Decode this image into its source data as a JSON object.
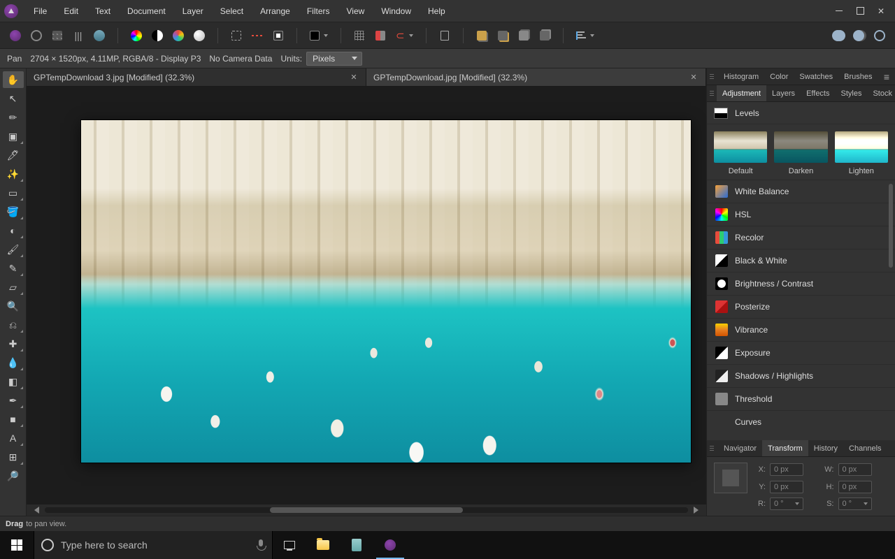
{
  "menubar": {
    "items": [
      "File",
      "Edit",
      "Text",
      "Document",
      "Layer",
      "Select",
      "Arrange",
      "Filters",
      "View",
      "Window",
      "Help"
    ]
  },
  "context": {
    "tool_mode": "Pan",
    "doc_info": "2704 × 1520px, 4.11MP, RGBA/8 - Display P3",
    "camera": "No Camera Data",
    "units_label": "Units:",
    "units_value": "Pixels"
  },
  "tabs": [
    {
      "title": "GPTempDownload 3.jpg [Modified] (32.3%)",
      "active": false
    },
    {
      "title": "GPTempDownload.jpg [Modified] (32.3%)",
      "active": true
    }
  ],
  "tools": [
    {
      "name": "hand-tool",
      "glyph": "✋",
      "active": true,
      "corner": false
    },
    {
      "name": "move-tool",
      "glyph": "↖",
      "active": false,
      "corner": false
    },
    {
      "name": "color-picker-tool",
      "glyph": "✏",
      "active": false,
      "corner": false
    },
    {
      "name": "crop-tool",
      "glyph": "▣",
      "active": false,
      "corner": true
    },
    {
      "name": "brush-picker-tool",
      "glyph": "🖊",
      "active": false,
      "corner": false
    },
    {
      "name": "wand-tool",
      "glyph": "✨",
      "active": false,
      "corner": true
    },
    {
      "name": "marquee-tool",
      "glyph": "▭",
      "active": false,
      "corner": true
    },
    {
      "name": "flood-fill-tool",
      "glyph": "🪣",
      "active": false,
      "corner": true
    },
    {
      "name": "gradient-tool",
      "glyph": "◐",
      "active": false,
      "corner": true
    },
    {
      "name": "paint-brush-tool",
      "glyph": "🖌",
      "active": false,
      "corner": true
    },
    {
      "name": "pixel-brush-tool",
      "glyph": "✎",
      "active": false,
      "corner": true
    },
    {
      "name": "eraser-tool",
      "glyph": "▱",
      "active": false,
      "corner": true
    },
    {
      "name": "zoom-tool-2",
      "glyph": "🔍",
      "active": false,
      "corner": false
    },
    {
      "name": "clone-tool",
      "glyph": "⎌",
      "active": false,
      "corner": true
    },
    {
      "name": "heal-tool",
      "glyph": "✚",
      "active": false,
      "corner": true
    },
    {
      "name": "blur-tool",
      "glyph": "💧",
      "active": false,
      "corner": true
    },
    {
      "name": "patch-tool",
      "glyph": "◧",
      "active": false,
      "corner": true
    },
    {
      "name": "pen-tool",
      "glyph": "✒",
      "active": false,
      "corner": true
    },
    {
      "name": "shape-tool",
      "glyph": "■",
      "active": false,
      "corner": true
    },
    {
      "name": "text-tool",
      "glyph": "A",
      "active": false,
      "corner": true
    },
    {
      "name": "mesh-tool",
      "glyph": "⊞",
      "active": false,
      "corner": true
    },
    {
      "name": "zoom-tool",
      "glyph": "🔎",
      "active": false,
      "corner": false
    }
  ],
  "panel_row1": {
    "tabs": [
      "Histogram",
      "Color",
      "Swatches",
      "Brushes"
    ],
    "active": null
  },
  "panel_row2": {
    "tabs": [
      "Adjustment",
      "Layers",
      "Effects",
      "Styles",
      "Stock"
    ],
    "active": "Adjustment",
    "levels_label": "Levels",
    "presets": [
      {
        "name": "Default",
        "class": ""
      },
      {
        "name": "Darken",
        "class": "dark"
      },
      {
        "name": "Lighten",
        "class": "light"
      }
    ],
    "adjustments": [
      {
        "label": "White Balance",
        "bg": "linear-gradient(135deg,#f6a13a,#2a6bd4)"
      },
      {
        "label": "HSL",
        "bg": "conic-gradient(red,yellow,lime,cyan,blue,magenta,red)"
      },
      {
        "label": "Recolor",
        "bg": "linear-gradient(90deg,#e74c3c 33%,#2ecc71 33% 66%,#3498db 66%)"
      },
      {
        "label": "Black & White",
        "bg": "linear-gradient(135deg,#fff 50%,#000 50%)"
      },
      {
        "label": "Brightness / Contrast",
        "bg": "radial-gradient(circle,#fff 45%,#000 48%)"
      },
      {
        "label": "Posterize",
        "bg": "linear-gradient(135deg,#d33 50%,#a11 50%)"
      },
      {
        "label": "Vibrance",
        "bg": "linear-gradient(#f7d000,#e67e22,#d35400)"
      },
      {
        "label": "Exposure",
        "bg": "linear-gradient(135deg,#000 50%,#fff 50%)"
      },
      {
        "label": "Shadows / Highlights",
        "bg": "linear-gradient(135deg,#222 50%,#eee 50%)"
      },
      {
        "label": "Threshold",
        "bg": "linear-gradient(#888,#888)"
      },
      {
        "label": "Curves",
        "bg": "linear-gradient(#333,#333)"
      }
    ]
  },
  "panel_row3": {
    "tabs": [
      "Navigator",
      "Transform",
      "History",
      "Channels"
    ],
    "active": "Transform",
    "fields": {
      "x_label": "X:",
      "x": "0 px",
      "y_label": "Y:",
      "y": "0 px",
      "w_label": "W:",
      "w": "0 px",
      "h_label": "H:",
      "h": "0 px",
      "r_label": "R:",
      "r": "0 °",
      "s_label": "S:",
      "s": "0 °"
    }
  },
  "status": {
    "strong": "Drag",
    "rest": "to pan view."
  },
  "taskbar": {
    "search_placeholder": "Type here to search"
  }
}
